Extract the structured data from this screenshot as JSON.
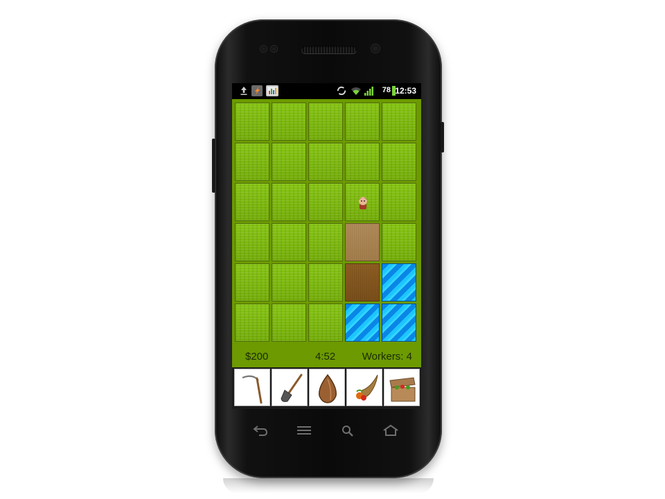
{
  "status_bar": {
    "notification_icons": [
      "upload-icon",
      "flash-app-icon",
      "chart-app-icon"
    ],
    "system_icons": [
      "sync-icon",
      "wifi-icon",
      "signal-icon"
    ],
    "battery": "78",
    "time": "12:53"
  },
  "game": {
    "grid": [
      [
        "grass",
        "grass",
        "grass",
        "grass",
        "grass"
      ],
      [
        "grass",
        "grass",
        "grass",
        "grass",
        "grass"
      ],
      [
        "grass",
        "grass",
        "grass",
        "grass-worker",
        "grass"
      ],
      [
        "grass",
        "grass",
        "grass",
        "dirt-light",
        "grass"
      ],
      [
        "grass",
        "grass",
        "grass",
        "dirt-dark",
        "water"
      ],
      [
        "grass",
        "grass",
        "grass",
        "water",
        "water"
      ]
    ],
    "money": "$200",
    "timer": "4:52",
    "workers": "Workers: 4"
  },
  "tools": [
    "scythe-icon",
    "shovel-icon",
    "seed-icon",
    "cornucopia-icon",
    "crate-icon"
  ],
  "nav_buttons": [
    "back-icon",
    "menu-icon",
    "search-icon",
    "home-icon"
  ],
  "colors": {
    "field_bg": "#6c9a00",
    "grass": "#7cb80f",
    "water": "#1cc6ff",
    "dirt_light": "#a9844f",
    "dirt_dark": "#84561e"
  }
}
